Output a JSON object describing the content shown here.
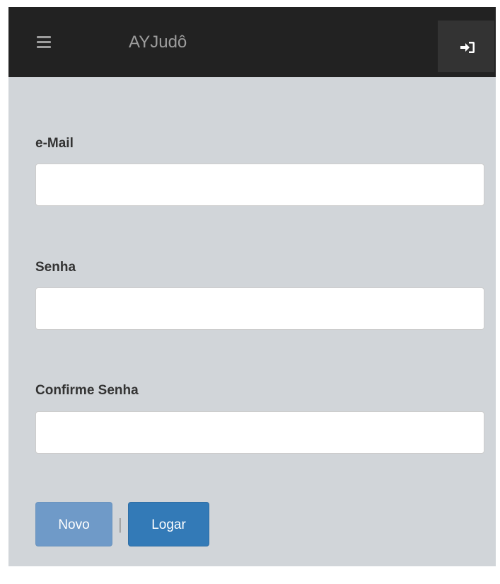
{
  "navbar": {
    "brand": "AYJudô",
    "menu_icon": "hamburger-menu-icon",
    "login_icon": "sign-in-icon"
  },
  "form": {
    "email_label": "e-Mail",
    "email_value": "",
    "password_label": "Senha",
    "password_value": "",
    "confirm_label": "Confirme Senha",
    "confirm_value": ""
  },
  "actions": {
    "novo_label": "Novo",
    "separator": "|",
    "logar_label": "Logar"
  },
  "colors": {
    "navbar_bg": "#222222",
    "page_bg": "#d1d5d9",
    "primary": "#337ab7",
    "primary_disabled": "#6f9ac8"
  }
}
